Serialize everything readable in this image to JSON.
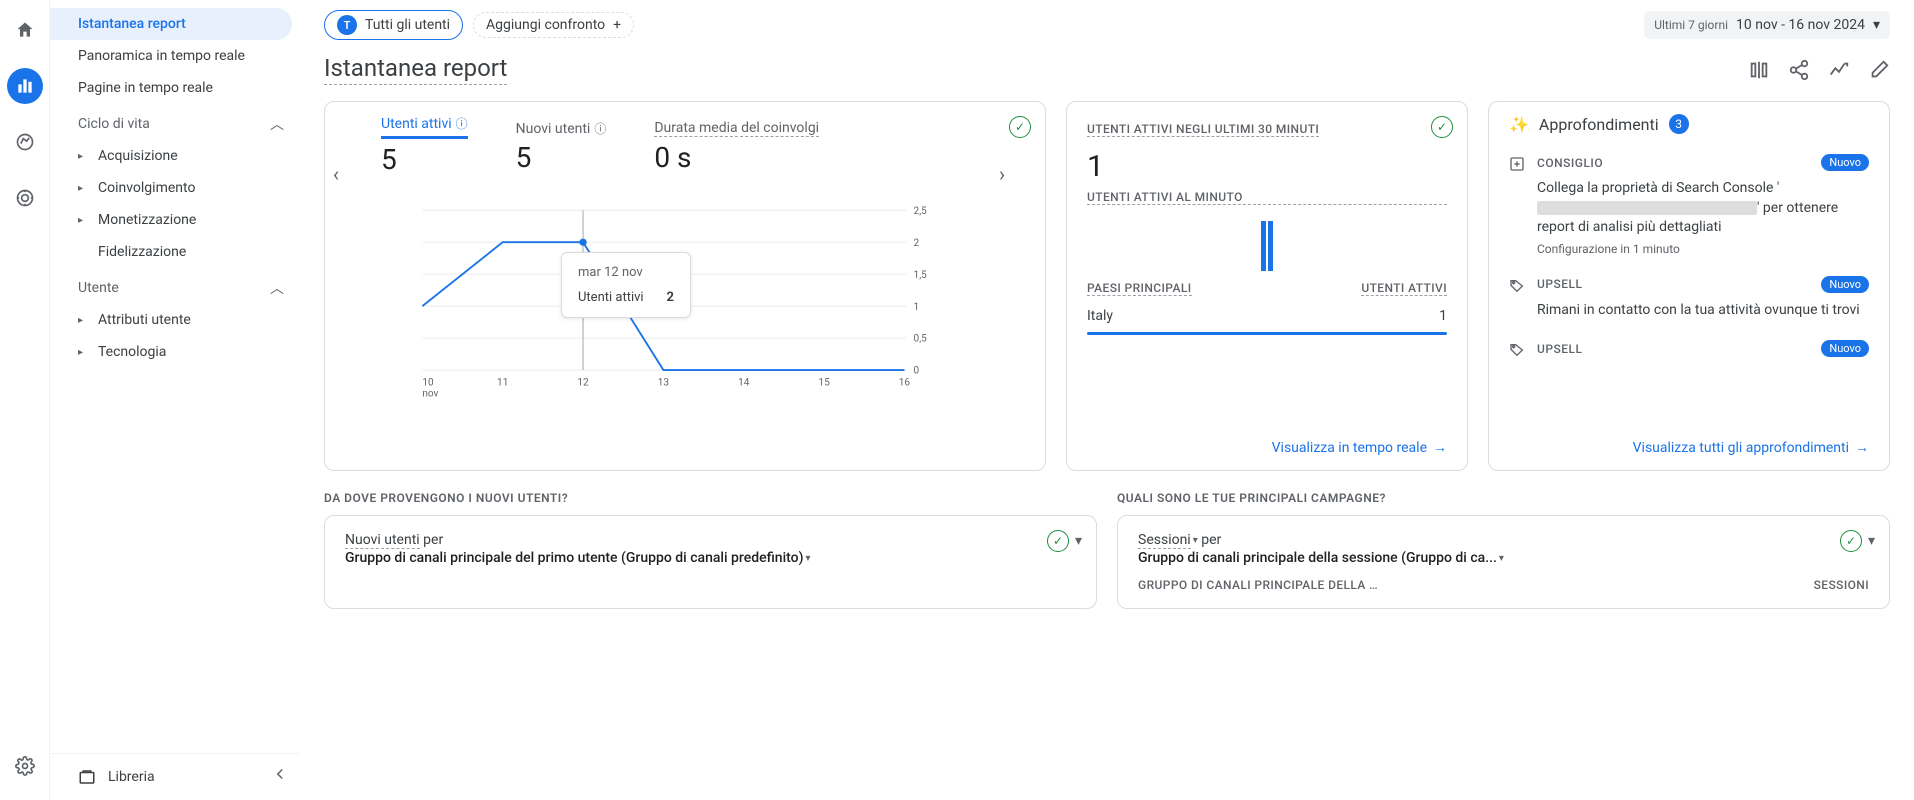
{
  "rail": {
    "items": [
      "home",
      "reports",
      "explore",
      "ads",
      "admin"
    ]
  },
  "sidebar": {
    "items": [
      {
        "label": "Istantanea report",
        "selected": true
      },
      {
        "label": "Panoramica in tempo reale"
      },
      {
        "label": "Pagine in tempo reale"
      }
    ],
    "sections": [
      {
        "label": "Ciclo di vita",
        "subs": [
          {
            "label": "Acquisizione",
            "exp": true
          },
          {
            "label": "Coinvolgimento",
            "exp": true
          },
          {
            "label": "Monetizzazione",
            "exp": true
          },
          {
            "label": "Fidelizzazione",
            "exp": false
          }
        ]
      },
      {
        "label": "Utente",
        "subs": [
          {
            "label": "Attributi utente",
            "exp": true
          },
          {
            "label": "Tecnologia",
            "exp": true
          }
        ]
      }
    ],
    "library": "Libreria"
  },
  "topbar": {
    "audience_badge": "T",
    "audience_label": "Tutti gli utenti",
    "add_compare": "Aggiungi confronto",
    "date_label": "Ultimi 7 giorni",
    "date_value": "10 nov - 16 nov 2024"
  },
  "title": "Istantanea report",
  "card1": {
    "metrics": [
      {
        "label": "Utenti attivi",
        "value": "5",
        "active": true,
        "info": true
      },
      {
        "label": "Nuovi utenti",
        "value": "5",
        "info": true
      },
      {
        "label": "Durata media del coinvolgi",
        "value": "0 s"
      }
    ],
    "tooltip": {
      "date": "mar 12 nov",
      "label": "Utenti attivi",
      "value": "2"
    },
    "yticks": [
      "2,5",
      "2",
      "1,5",
      "1",
      "0,5",
      "0"
    ],
    "xlabels": [
      "10 nov",
      "11",
      "12",
      "13",
      "14",
      "15",
      "16"
    ]
  },
  "card2": {
    "title": "UTENTI ATTIVI NEGLI ULTIMI 30 MINUTI",
    "value": "1",
    "subtitle": "UTENTI ATTIVI AL MINUTO",
    "col1": "PAESI PRINCIPALI",
    "col2": "UTENTI ATTIVI",
    "rows": [
      {
        "country": "Italy",
        "count": "1"
      }
    ],
    "link": "Visualizza in tempo reale"
  },
  "card3": {
    "title": "Approfondimenti",
    "count": "3",
    "items": [
      {
        "tag": "CONSIGLIO",
        "pill": "Nuovo",
        "body": "Collega la proprietà di Search Console",
        "body2": "per ottenere report di analisi più dettagliati",
        "sub": "Configurazione in 1 minuto",
        "redact": true
      },
      {
        "tag": "UPSELL",
        "pill": "Nuovo",
        "body": "Rimani in contatto con la tua attività ovunque ti trovi"
      },
      {
        "tag": "UPSELL",
        "pill": "Nuovo"
      }
    ],
    "link": "Visualizza tutti gli approfondimenti"
  },
  "bottom": {
    "q1": "DA DOVE PROVENGONO I NUOVI UTENTI?",
    "q2": "QUALI SONO LE TUE PRINCIPALI CAMPAGNE?",
    "b1": {
      "t1": "Nuovi utenti",
      "t1s": "per",
      "sub": "Gruppo di canali principale del primo utente (Gruppo di canali predefinito)"
    },
    "b2": {
      "t1": "Sessioni",
      "t1s": "per",
      "sub": "Gruppo di canali principale della sessione (Gruppo di ca...",
      "col1": "GRUPPO DI CANALI PRINCIPALE DELLA …",
      "col2": "SESSIONI"
    }
  },
  "chart_data": {
    "type": "line",
    "title": "Utenti attivi",
    "x": [
      "10",
      "11",
      "12",
      "13",
      "14",
      "15",
      "16"
    ],
    "xlabel": "nov",
    "series": [
      {
        "name": "Utenti attivi",
        "values": [
          1,
          2,
          2,
          0,
          0,
          0,
          0
        ]
      }
    ],
    "ylim": [
      0,
      2.5
    ],
    "yticks": [
      0,
      0.5,
      1,
      1.5,
      2,
      2.5
    ]
  }
}
